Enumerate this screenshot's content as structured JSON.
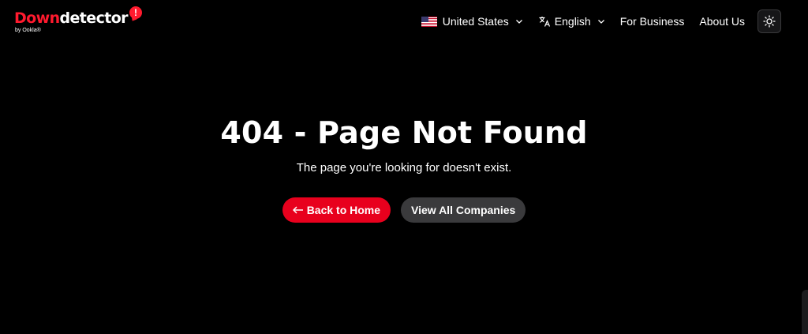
{
  "brand": {
    "name_part1": "Down",
    "name_part2": "detector",
    "badge": "!",
    "byline": "by Ookla®",
    "accent_color": "#e8001d"
  },
  "nav": {
    "country": {
      "label": "United States",
      "icon": "us-flag-icon"
    },
    "language": {
      "label": "English",
      "icon": "translate-icon"
    },
    "for_business": "For Business",
    "about_us": "About Us",
    "theme_toggle_icon": "sun-icon"
  },
  "error": {
    "title": "404 - Page Not Found",
    "message": "The page you're looking for doesn't exist."
  },
  "actions": {
    "back_home": "Back to Home",
    "view_companies": "View All Companies"
  }
}
